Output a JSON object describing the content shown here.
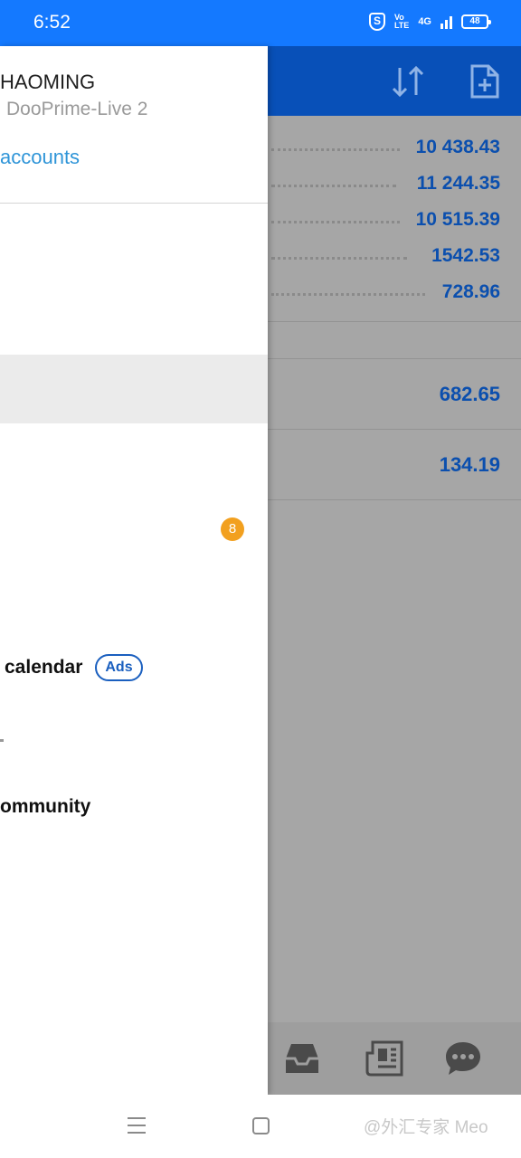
{
  "status_bar": {
    "time": "6:52",
    "shield_glyph": "S",
    "volte_top": "Vo",
    "volte_bottom": "LTE",
    "network": "4G",
    "battery": "48",
    "color": "#1479ff"
  },
  "app": {
    "header_color": "#0850b8",
    "header_icons": [
      "sort-arrows-icon",
      "new-document-icon"
    ],
    "account_values": [
      "10 438.43",
      "11 244.35",
      "10 515.39",
      "1542.53",
      "728.96"
    ],
    "row_values": [
      "682.65",
      "134.19"
    ],
    "bottom_nav_icons": [
      "inbox-icon",
      "news-icon",
      "chat-icon"
    ]
  },
  "drawer": {
    "account_name": "HAOMING",
    "server": "DooPrime-Live 2",
    "manage_accounts": "accounts",
    "mailbox_badge": "8",
    "economic_calendar": "calendar",
    "ads_label": "Ads",
    "community": "ommunity"
  },
  "system_nav": {
    "watermark": "@外汇专家 Meo"
  }
}
